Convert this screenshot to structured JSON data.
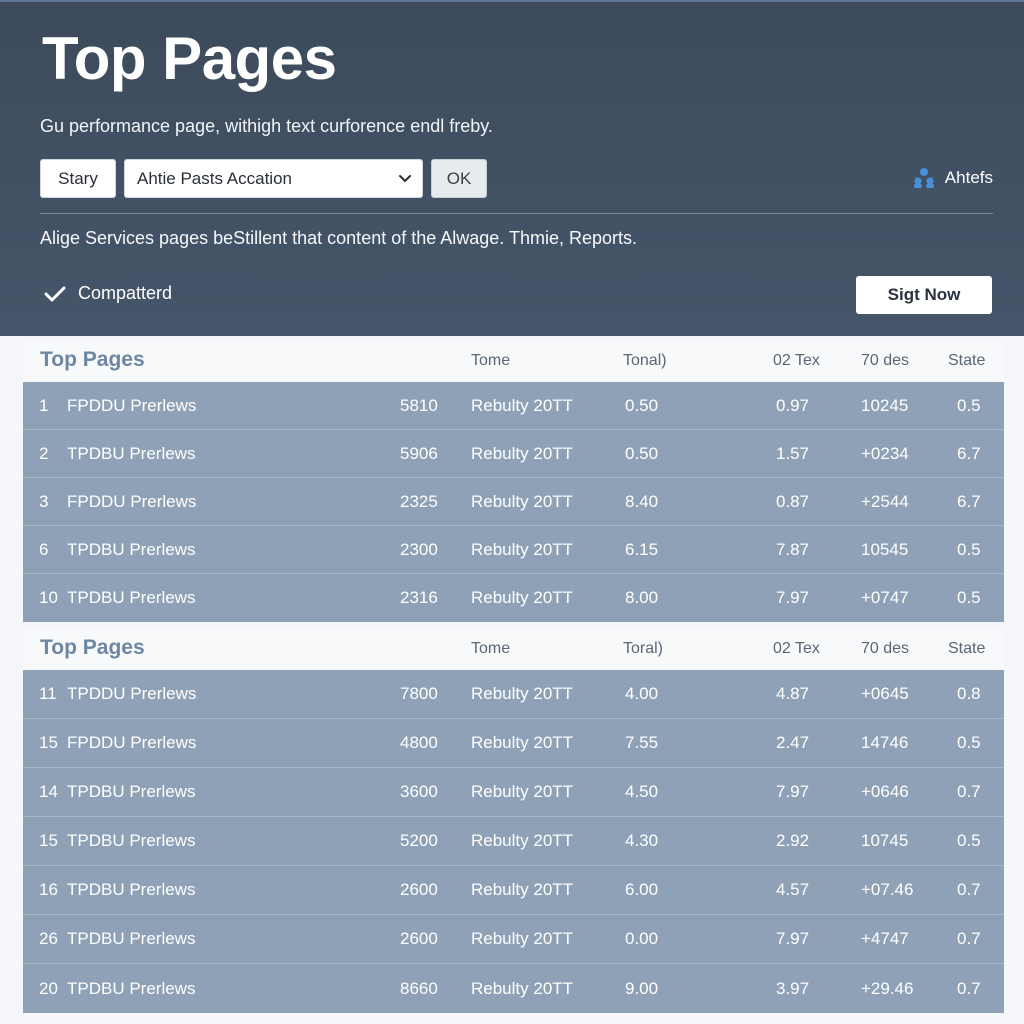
{
  "header": {
    "title": "Top Pages",
    "subtitle": "Gu performance page, withigh text curforence endl freby.",
    "stary_label": "Stary",
    "select_value": "Ahtie Pasts Accation",
    "ok_label": "OK",
    "brand_label": "Ahtefs",
    "description": "Alige Services pages beStillent that content of the Alwage. Thmie, Reports.",
    "status_label": "Compatterd",
    "sign_label": "Sigt Now"
  },
  "tables": [
    {
      "title": "Top Pages",
      "columns": [
        "Tome",
        "Tonal)",
        "02 Tex",
        "70 des",
        "State"
      ],
      "rows": [
        {
          "num": "1",
          "name": "FPDDU Prerlews",
          "count": "5810",
          "tome": "Rebulty 20TT",
          "tonal": "0.50",
          "tex": "0.97",
          "des": "10245",
          "state": "0.5"
        },
        {
          "num": "2",
          "name": "TPDBU Prerlews",
          "count": "5906",
          "tome": "Rebulty 20TT",
          "tonal": "0.50",
          "tex": "1.57",
          "des": "+0234",
          "state": "6.7"
        },
        {
          "num": "3",
          "name": "FPDDU Prerlews",
          "count": "2325",
          "tome": "Rebulty 20TT",
          "tonal": "8.40",
          "tex": "0.87",
          "des": "+2544",
          "state": "6.7"
        },
        {
          "num": "6",
          "name": "TPDBU Prerlews",
          "count": "2300",
          "tome": "Rebulty 20TT",
          "tonal": "6.15",
          "tex": "7.87",
          "des": "10545",
          "state": "0.5"
        },
        {
          "num": "10",
          "name": "TPDBU Prerlews",
          "count": "2316",
          "tome": "Rebulty 20TT",
          "tonal": "8.00",
          "tex": "7.97",
          "des": "+0747",
          "state": "0.5"
        }
      ]
    },
    {
      "title": "Top Pages",
      "columns": [
        "Tome",
        "Toral)",
        "02 Tex",
        "70 des",
        "State"
      ],
      "rows": [
        {
          "num": "11",
          "name": "TPDDU Prerlews",
          "count": "7800",
          "tome": "Rebulty 20TT",
          "tonal": "4.00",
          "tex": "4.87",
          "des": "+0645",
          "state": "0.8"
        },
        {
          "num": "15",
          "name": "FPDDU Prerlews",
          "count": "4800",
          "tome": "Rebulty 20TT",
          "tonal": "7.55",
          "tex": "2.47",
          "des": "14746",
          "state": "0.5"
        },
        {
          "num": "14",
          "name": "TPDBU Prerlews",
          "count": "3600",
          "tome": "Rebulty 20TT",
          "tonal": "4.50",
          "tex": "7.97",
          "des": "+0646",
          "state": "0.7"
        },
        {
          "num": "15",
          "name": "TPDBU Prerlews",
          "count": "5200",
          "tome": "Rebulty 20TT",
          "tonal": "4.30",
          "tex": "2.92",
          "des": "10745",
          "state": "0.5"
        },
        {
          "num": "16",
          "name": "TPDBU Prerlews",
          "count": "2600",
          "tome": "Rebulty 20TT",
          "tonal": "6.00",
          "tex": "4.57",
          "des": "+07.46",
          "state": "0.7"
        },
        {
          "num": "26",
          "name": "TPDBU Prerlews",
          "count": "2600",
          "tome": "Rebulty 20TT",
          "tonal": "0.00",
          "tex": "7.97",
          "des": "+4747",
          "state": "0.7"
        },
        {
          "num": "20",
          "name": "TPDBU Prerlews",
          "count": "8660",
          "tome": "Rebulty 20TT",
          "tonal": "9.00",
          "tex": "3.97",
          "des": "+29.46",
          "state": "0.7"
        }
      ]
    }
  ],
  "colors": {
    "header_bg": "#3c4a5b",
    "row_bg": "#8fa1b6",
    "table_title": "#6d86a4",
    "brand_icon": "#4a90d9"
  },
  "icons": {
    "brand": "users-icon",
    "status": "check-icon",
    "select": "chevron-down-icon"
  }
}
